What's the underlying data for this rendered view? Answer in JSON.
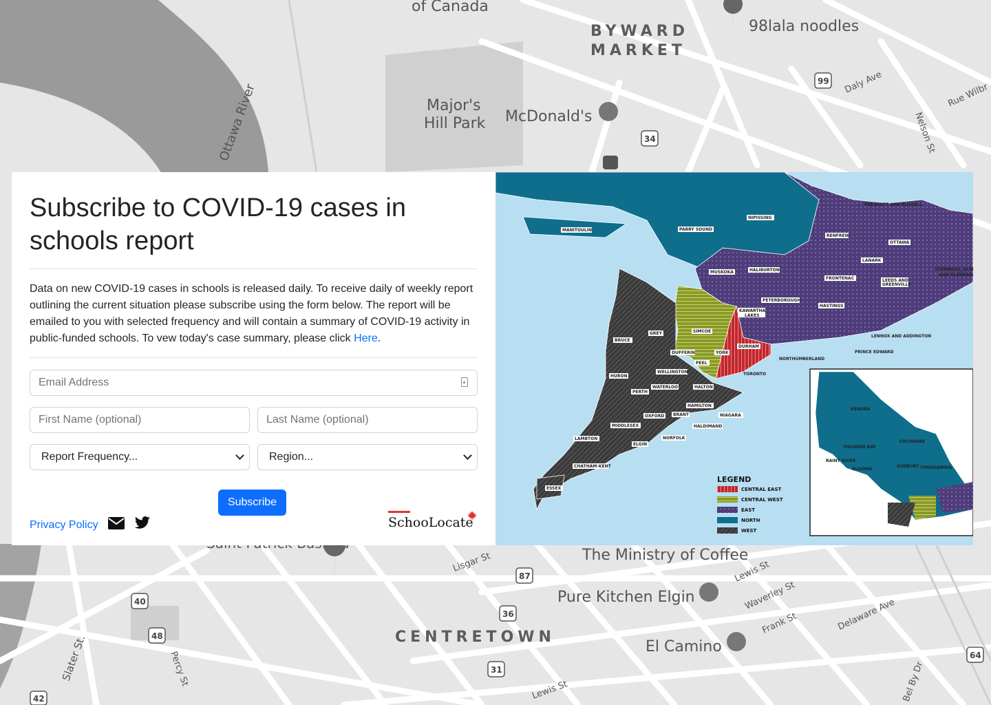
{
  "background_map": {
    "districts": [
      "BYWARD",
      "MARKET",
      "CENTRETOWN"
    ],
    "places": [
      "of Canada",
      "98lala noodles",
      "Major's",
      "Hill Park",
      "McDonald's",
      "Ottawa River",
      "Saint Patrick Basilica",
      "The Ministry of Coffee",
      "Pure Kitchen Elgin",
      "El Camino"
    ],
    "streets": [
      "Daly Ave",
      "Rue Wilbr",
      "Nelson St",
      "Lisgar St",
      "Lewis St",
      "Waverley St",
      "Frank St",
      "Delaware Ave",
      "Slater St.",
      "Percy St",
      "Lewis St",
      "Bel By Dr"
    ],
    "highways": [
      "99",
      "34",
      "87",
      "40",
      "36",
      "48",
      "31",
      "42",
      "64"
    ]
  },
  "form": {
    "title": "Subscribe to COVID-19 cases in schools report",
    "description": "Data on new COVID-19 cases in schools is released daily. To receive daily of weekly report outlining the current situation please subscribe using the form below. The report will be emailed to you with selected frequency and will contain a summary of COVID-19 activity in public-funded schools. To vew today's case summary, please click ",
    "here_link": "Here",
    "period": ".",
    "email_placeholder": "Email Address",
    "first_name_placeholder": "First Name (optional)",
    "last_name_placeholder": "Last Name (optional)",
    "frequency_select": "Report Frequency...",
    "region_select": "Region...",
    "submit_label": "Subscribe"
  },
  "footer": {
    "privacy_label": "Privacy Policy",
    "icons": [
      "envelope-icon",
      "twitter-icon"
    ],
    "brand": "SchooLocate"
  },
  "ontario_map": {
    "region_colors": {
      "central_east": "#c0272d",
      "central_west": "#8a9a2a",
      "east": "#4e3d7a",
      "north": "#0e6e8c",
      "west": "#3a3a3a",
      "water": "#b8def2"
    },
    "labels": [
      "MANITOULIN",
      "PARRY SOUND",
      "NIPISSING",
      "PRESCOTT AND RUSSELL",
      "RENFREW",
      "OTTAWA",
      "MUSKOKA",
      "HALIBURTON",
      "LANARK",
      "STORMONT, DUNDAS AND GLENGARRY",
      "FRONTENAC",
      "LEEDS AND GREENVILLE",
      "PETERBOROUGH",
      "HASTINGS",
      "KAWARTHA LAKES",
      "LENNOX AND ADDINGTON",
      "SIMCOE",
      "GREY",
      "BRUCE",
      "DURHAM",
      "PRINCE EDWARD",
      "NORTHUMBERLAND",
      "DUFFERIN",
      "YORK",
      "PEEL",
      "TORONTO",
      "HURON",
      "WELLINGTON",
      "HALTON",
      "PERTH",
      "WATERLOO",
      "HAMILTON",
      "BRANT",
      "NIAGARA",
      "OXFORD",
      "MIDDLESEX",
      "HALDIMAND",
      "NORFOLK",
      "LAMBTON",
      "ELGIN",
      "CHATHAM-KENT",
      "ESSEX"
    ],
    "inset_labels": [
      "KENORA",
      "COCHRANE",
      "THUNDER BAY",
      "RAINY RIVER",
      "ALGOMA",
      "SUDBURY",
      "TIMISKAMING"
    ],
    "legend": {
      "title": "LEGEND",
      "items": [
        "CENTRAL EAST",
        "CENTRAL WEST",
        "EAST",
        "NORTH",
        "WEST"
      ]
    }
  }
}
